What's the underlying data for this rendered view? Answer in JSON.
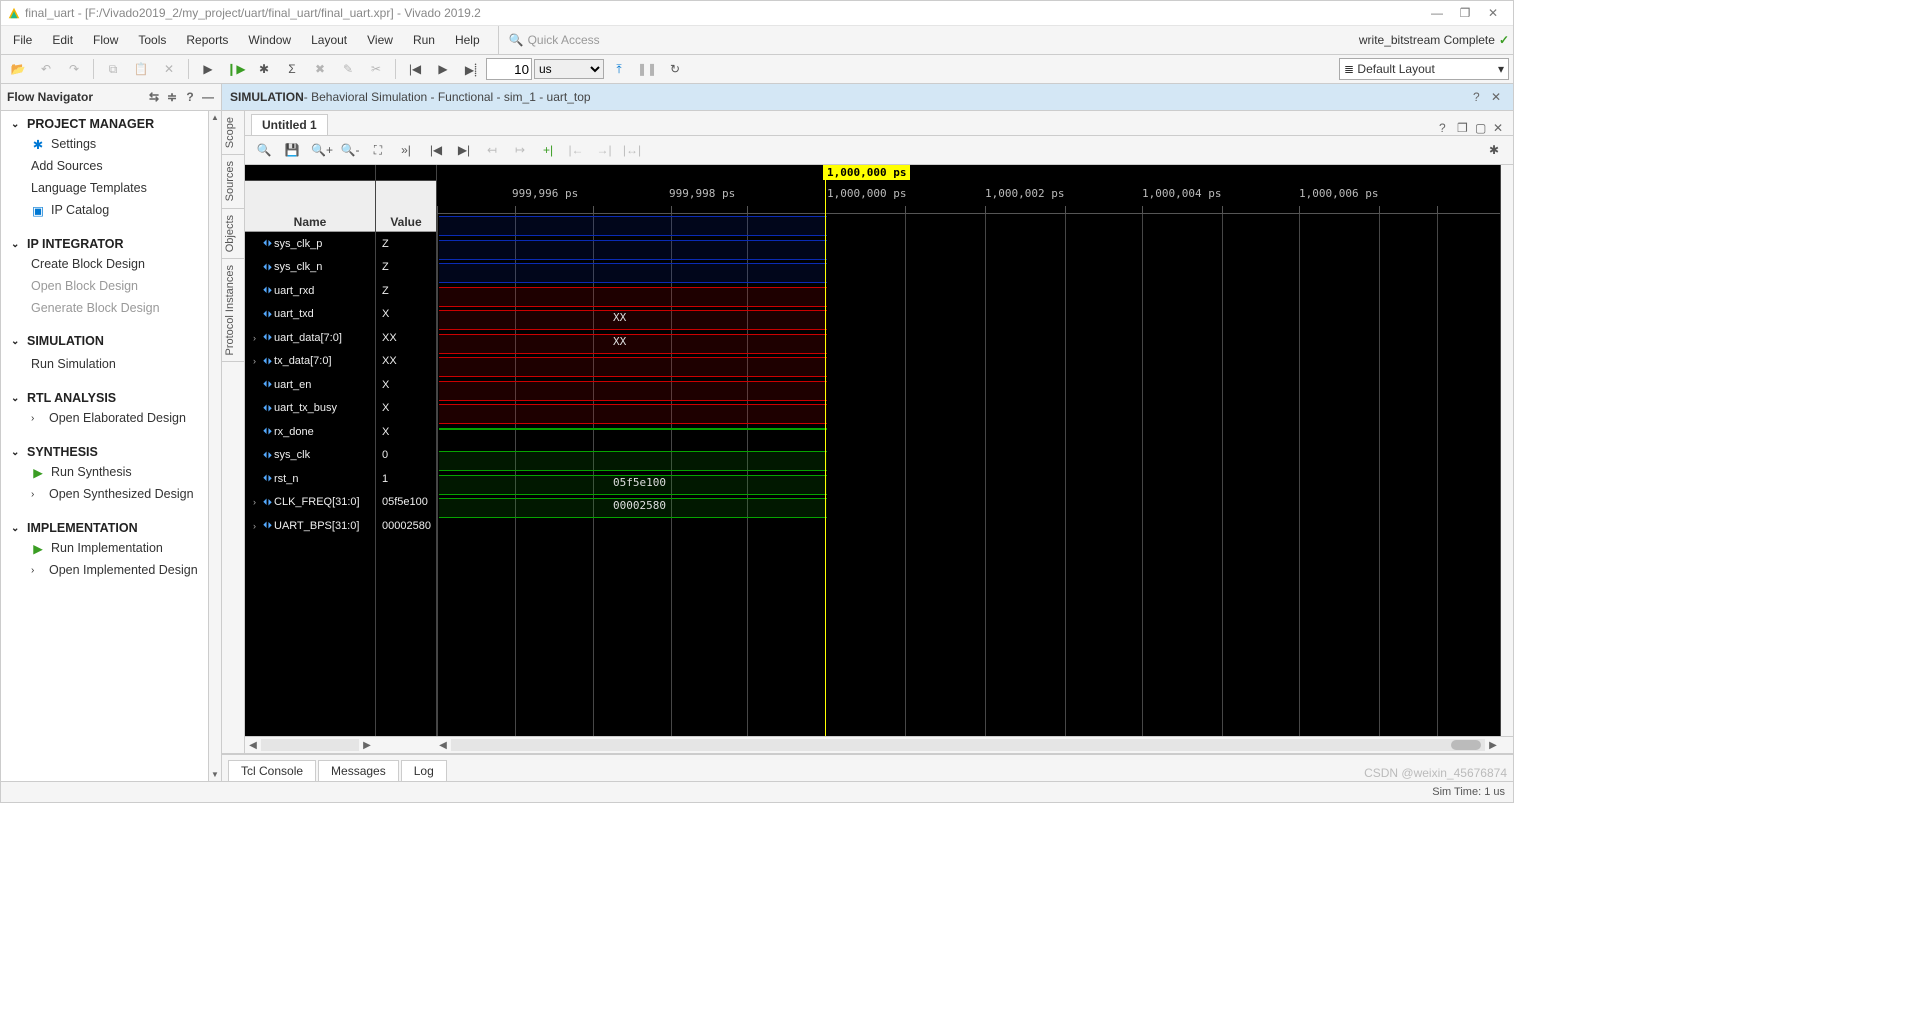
{
  "window_title": "final_uart - [F:/Vivado2019_2/my_project/uart/final_uart/final_uart.xpr] - Vivado 2019.2",
  "menu": [
    "File",
    "Edit",
    "Flow",
    "Tools",
    "Reports",
    "Window",
    "Layout",
    "View",
    "Run",
    "Help"
  ],
  "quick_access_placeholder": "Quick Access",
  "status_msg": "write_bitstream Complete",
  "layout_name": "Default Layout",
  "time_value": "10",
  "time_unit": "us",
  "nav_title": "Flow Navigator",
  "nav": {
    "pm": {
      "title": "PROJECT MANAGER",
      "items": [
        "Settings",
        "Add Sources",
        "Language Templates",
        "IP Catalog"
      ]
    },
    "ip": {
      "title": "IP INTEGRATOR",
      "items": [
        "Create Block Design",
        "Open Block Design",
        "Generate Block Design"
      ]
    },
    "sim": {
      "title": "SIMULATION",
      "items": [
        "Run Simulation"
      ]
    },
    "rtl": {
      "title": "RTL ANALYSIS",
      "items": [
        "Open Elaborated Design"
      ]
    },
    "syn": {
      "title": "SYNTHESIS",
      "items": [
        "Run Synthesis",
        "Open Synthesized Design"
      ]
    },
    "imp": {
      "title": "IMPLEMENTATION",
      "items": [
        "Run Implementation",
        "Open Implemented Design"
      ]
    }
  },
  "sim_header_bold": "SIMULATION",
  "sim_header_rest": " - Behavioral Simulation - Functional - sim_1 - uart_top",
  "side_tabs": [
    "Scope",
    "Sources",
    "Objects",
    "Protocol Instances"
  ],
  "wave_tab": "Untitled 1",
  "name_hdr": "Name",
  "value_hdr": "Value",
  "marker_label": "1,000,000 ps",
  "ruler_ticks": [
    {
      "l": 75,
      "t": "999,996 ps"
    },
    {
      "l": 232,
      "t": "999,998 ps"
    },
    {
      "l": 390,
      "t": "1,000,000 ps"
    },
    {
      "l": 548,
      "t": "1,000,002 ps"
    },
    {
      "l": 705,
      "t": "1,000,004 ps"
    },
    {
      "l": 862,
      "t": "1,000,006 ps"
    }
  ],
  "signals": [
    {
      "n": "sys_clk_p",
      "v": "Z",
      "c": "blue",
      "bus": false
    },
    {
      "n": "sys_clk_n",
      "v": "Z",
      "c": "blue",
      "bus": false
    },
    {
      "n": "uart_rxd",
      "v": "Z",
      "c": "blue",
      "bus": false
    },
    {
      "n": "uart_txd",
      "v": "X",
      "c": "red",
      "bus": false
    },
    {
      "n": "uart_data[7:0]",
      "v": "XX",
      "c": "red",
      "bus": true,
      "lbl": "XX"
    },
    {
      "n": "tx_data[7:0]",
      "v": "XX",
      "c": "red",
      "bus": true,
      "lbl": "XX"
    },
    {
      "n": "uart_en",
      "v": "X",
      "c": "red",
      "bus": false
    },
    {
      "n": "uart_tx_busy",
      "v": "X",
      "c": "red",
      "bus": false
    },
    {
      "n": "rx_done",
      "v": "X",
      "c": "red",
      "bus": false
    },
    {
      "n": "sys_clk",
      "v": "0",
      "c": "greenline",
      "bus": false
    },
    {
      "n": "rst_n",
      "v": "1",
      "c": "green",
      "bus": false
    },
    {
      "n": "CLK_FREQ[31:0]",
      "v": "05f5e100",
      "c": "green",
      "bus": true,
      "lbl": "05f5e100"
    },
    {
      "n": "UART_BPS[31:0]",
      "v": "00002580",
      "c": "green",
      "bus": true,
      "lbl": "00002580"
    }
  ],
  "bottom_tabs": [
    "Tcl Console",
    "Messages",
    "Log"
  ],
  "sim_time": "Sim Time: 1 us",
  "watermark": "CSDN @weixin_45676874"
}
